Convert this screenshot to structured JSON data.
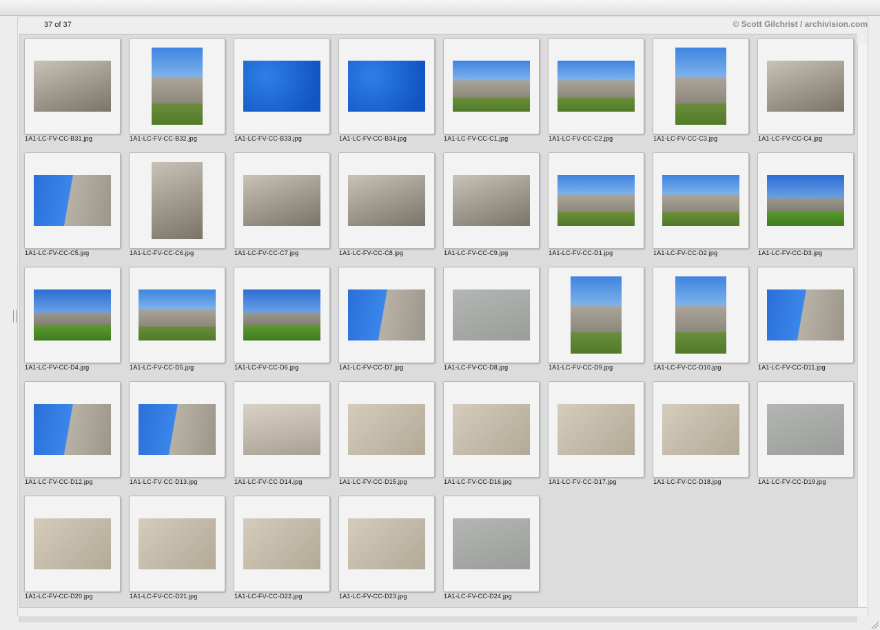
{
  "header": {
    "count": "37 of 37",
    "copyright": "© Scott Gilchrist / archivision.com"
  },
  "thumbnails": [
    {
      "file": "1A1-LC-FV-CC-B31.jpg",
      "orient": "land",
      "style": "p-concrete"
    },
    {
      "file": "1A1-LC-FV-CC-B32.jpg",
      "orient": "port",
      "style": "p-building-sky"
    },
    {
      "file": "1A1-LC-FV-CC-B33.jpg",
      "orient": "land",
      "style": "p-blue-lamp"
    },
    {
      "file": "1A1-LC-FV-CC-B34.jpg",
      "orient": "land",
      "style": "p-blue-lamp"
    },
    {
      "file": "1A1-LC-FV-CC-C1.jpg",
      "orient": "land",
      "style": "p-building-sky"
    },
    {
      "file": "1A1-LC-FV-CC-C2.jpg",
      "orient": "land",
      "style": "p-building-sky"
    },
    {
      "file": "1A1-LC-FV-CC-C3.jpg",
      "orient": "port",
      "style": "p-building-sky"
    },
    {
      "file": "1A1-LC-FV-CC-C4.jpg",
      "orient": "land",
      "style": "p-concrete"
    },
    {
      "file": "1A1-LC-FV-CC-C5.jpg",
      "orient": "land",
      "style": "p-sky-wall"
    },
    {
      "file": "1A1-LC-FV-CC-C6.jpg",
      "orient": "port",
      "style": "p-concrete"
    },
    {
      "file": "1A1-LC-FV-CC-C7.jpg",
      "orient": "land",
      "style": "p-concrete"
    },
    {
      "file": "1A1-LC-FV-CC-C8.jpg",
      "orient": "land",
      "style": "p-concrete"
    },
    {
      "file": "1A1-LC-FV-CC-C9.jpg",
      "orient": "land",
      "style": "p-concrete"
    },
    {
      "file": "1A1-LC-FV-CC-D1.jpg",
      "orient": "land",
      "style": "p-building-sky"
    },
    {
      "file": "1A1-LC-FV-CC-D2.jpg",
      "orient": "land",
      "style": "p-building-sky"
    },
    {
      "file": "1A1-LC-FV-CC-D3.jpg",
      "orient": "land",
      "style": "p-grass"
    },
    {
      "file": "1A1-LC-FV-CC-D4.jpg",
      "orient": "land",
      "style": "p-grass"
    },
    {
      "file": "1A1-LC-FV-CC-D5.jpg",
      "orient": "land",
      "style": "p-building-sky"
    },
    {
      "file": "1A1-LC-FV-CC-D6.jpg",
      "orient": "land",
      "style": "p-grass"
    },
    {
      "file": "1A1-LC-FV-CC-D7.jpg",
      "orient": "land",
      "style": "p-sky-wall"
    },
    {
      "file": "1A1-LC-FV-CC-D8.jpg",
      "orient": "land",
      "style": "p-grey"
    },
    {
      "file": "1A1-LC-FV-CC-D9.jpg",
      "orient": "port",
      "style": "p-building-sky"
    },
    {
      "file": "1A1-LC-FV-CC-D10.jpg",
      "orient": "port",
      "style": "p-building-sky"
    },
    {
      "file": "1A1-LC-FV-CC-D11.jpg",
      "orient": "land",
      "style": "p-sky-wall"
    },
    {
      "file": "1A1-LC-FV-CC-D12.jpg",
      "orient": "land",
      "style": "p-sky-wall"
    },
    {
      "file": "1A1-LC-FV-CC-D13.jpg",
      "orient": "land",
      "style": "p-sky-wall"
    },
    {
      "file": "1A1-LC-FV-CC-D14.jpg",
      "orient": "land",
      "style": "p-wall"
    },
    {
      "file": "1A1-LC-FV-CC-D15.jpg",
      "orient": "land",
      "style": "p-relief"
    },
    {
      "file": "1A1-LC-FV-CC-D16.jpg",
      "orient": "land",
      "style": "p-relief"
    },
    {
      "file": "1A1-LC-FV-CC-D17.jpg",
      "orient": "land",
      "style": "p-relief"
    },
    {
      "file": "1A1-LC-FV-CC-D18.jpg",
      "orient": "land",
      "style": "p-relief"
    },
    {
      "file": "1A1-LC-FV-CC-D19.jpg",
      "orient": "land",
      "style": "p-grey"
    },
    {
      "file": "1A1-LC-FV-CC-D20.jpg",
      "orient": "land",
      "style": "p-relief"
    },
    {
      "file": "1A1-LC-FV-CC-D21.jpg",
      "orient": "land",
      "style": "p-relief"
    },
    {
      "file": "1A1-LC-FV-CC-D22.jpg",
      "orient": "land",
      "style": "p-relief"
    },
    {
      "file": "1A1-LC-FV-CC-D23.jpg",
      "orient": "land",
      "style": "p-relief"
    },
    {
      "file": "1A1-LC-FV-CC-D24.jpg",
      "orient": "land",
      "style": "p-grey"
    }
  ]
}
